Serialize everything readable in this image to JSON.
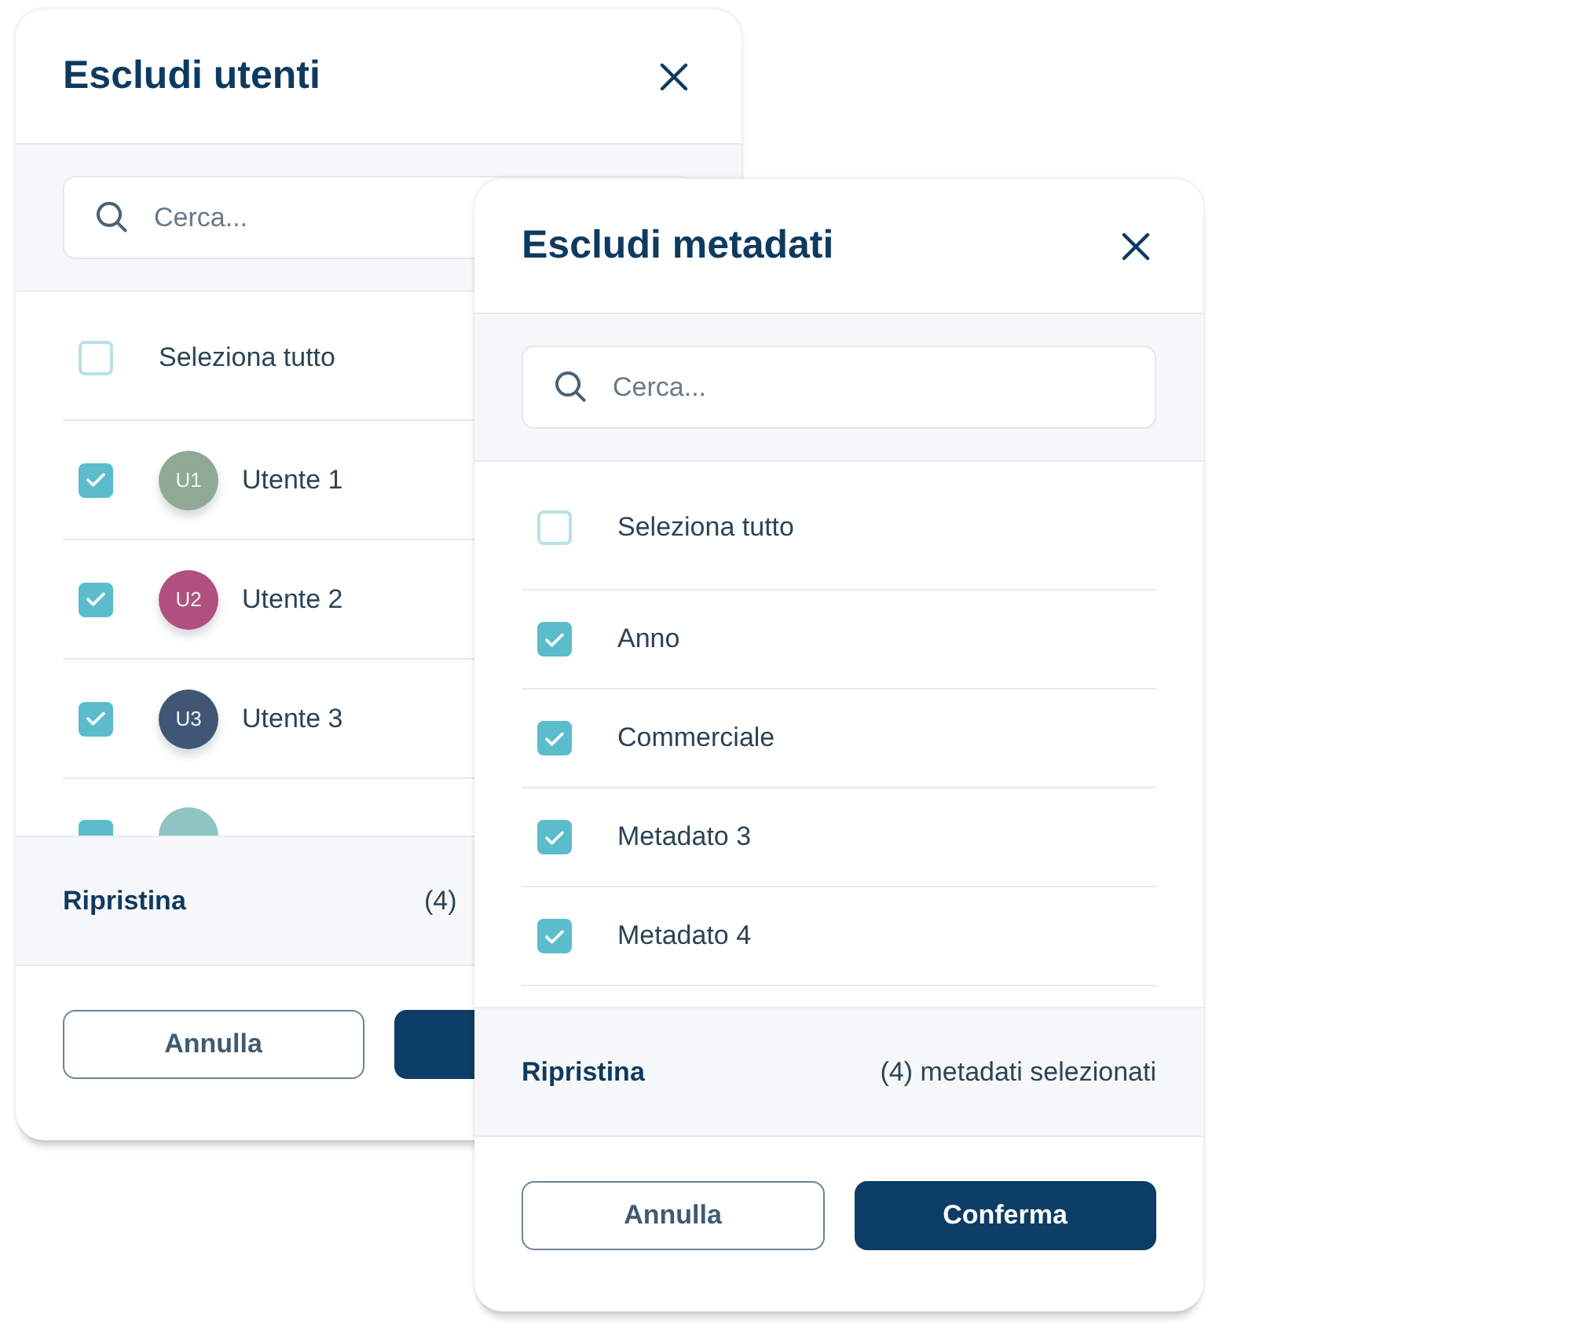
{
  "dialogs": [
    {
      "title": "Escludi utenti",
      "search": {
        "placeholder": "Cerca..."
      },
      "select_all": {
        "label": "Seleziona tutto",
        "checked": false
      },
      "items": [
        {
          "kind": "user",
          "label": "Utente 1",
          "checked": true,
          "avatar": {
            "initials": "U1",
            "color": "#8fa995"
          }
        },
        {
          "kind": "user",
          "label": "Utente 2",
          "checked": true,
          "avatar": {
            "initials": "U2",
            "color": "#b04f80"
          }
        },
        {
          "kind": "user",
          "label": "Utente 3",
          "checked": true,
          "avatar": {
            "initials": "U3",
            "color": "#3f5775"
          }
        },
        {
          "kind": "partial",
          "checked": true,
          "avatar": {
            "color": "#8fc4c5"
          }
        }
      ],
      "footer": {
        "reset": "Ripristina",
        "count": "(4)"
      },
      "buttons": [
        {
          "kind": "outline",
          "label": "Annulla"
        },
        {
          "kind": "primary"
        }
      ]
    },
    {
      "title": "Escludi metadati",
      "search": {
        "placeholder": "Cerca..."
      },
      "select_all": {
        "label": "Seleziona tutto",
        "checked": false
      },
      "items": [
        {
          "kind": "plain",
          "label": "Anno",
          "checked": true
        },
        {
          "kind": "plain",
          "label": "Commerciale",
          "checked": true
        },
        {
          "kind": "plain",
          "label": "Metadato 3",
          "checked": true
        },
        {
          "kind": "plain",
          "label": "Metadato 4",
          "checked": true
        }
      ],
      "footer": {
        "reset": "Ripristina",
        "count": "(4) metadati selezionati"
      },
      "buttons": [
        {
          "kind": "outline",
          "label": "Annulla"
        },
        {
          "kind": "primary",
          "label": "Conferma"
        }
      ]
    }
  ]
}
